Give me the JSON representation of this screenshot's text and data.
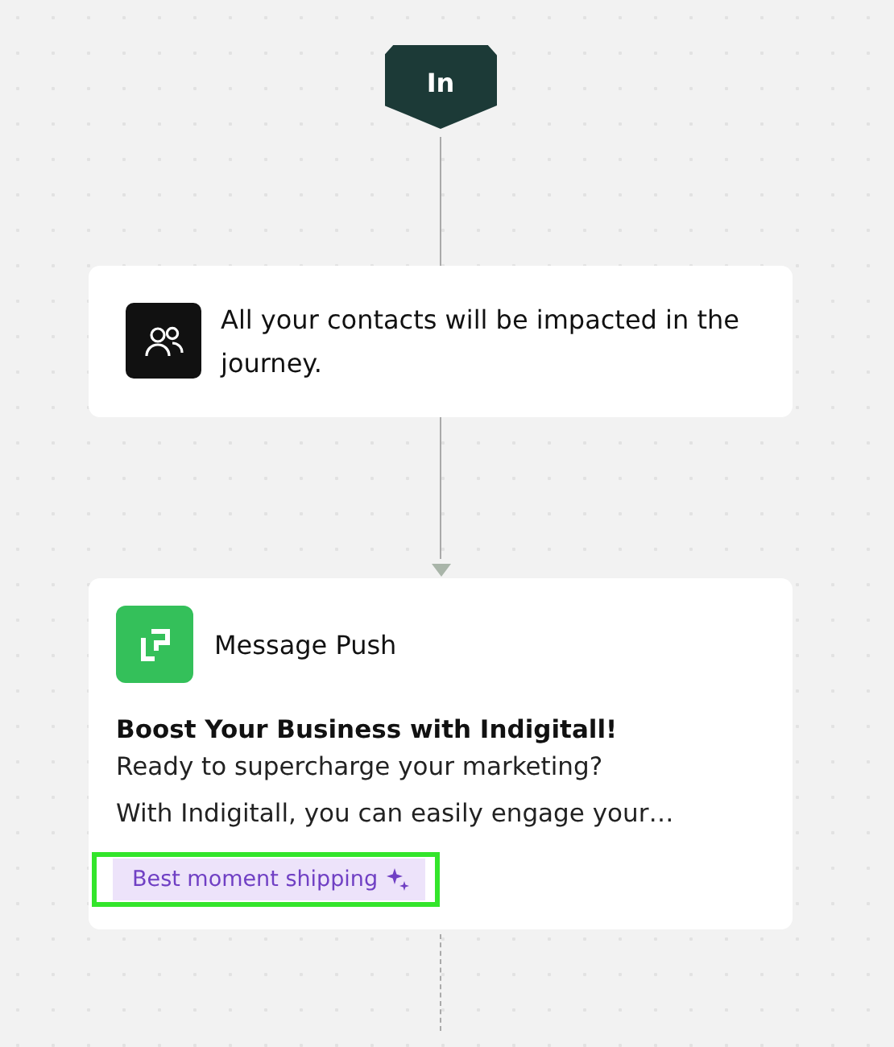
{
  "start_node": {
    "label": "In"
  },
  "audience_card": {
    "text": "All your contacts will be impacted in the journey."
  },
  "message_card": {
    "title": "Message Push",
    "headline": "Boost Your Business with Indigitall!",
    "lines": [
      "Ready to supercharge your marketing?",
      "With Indigitall, you can easily engage your…"
    ],
    "tag": {
      "label": "Best moment shipping",
      "highlighted": true
    }
  }
}
